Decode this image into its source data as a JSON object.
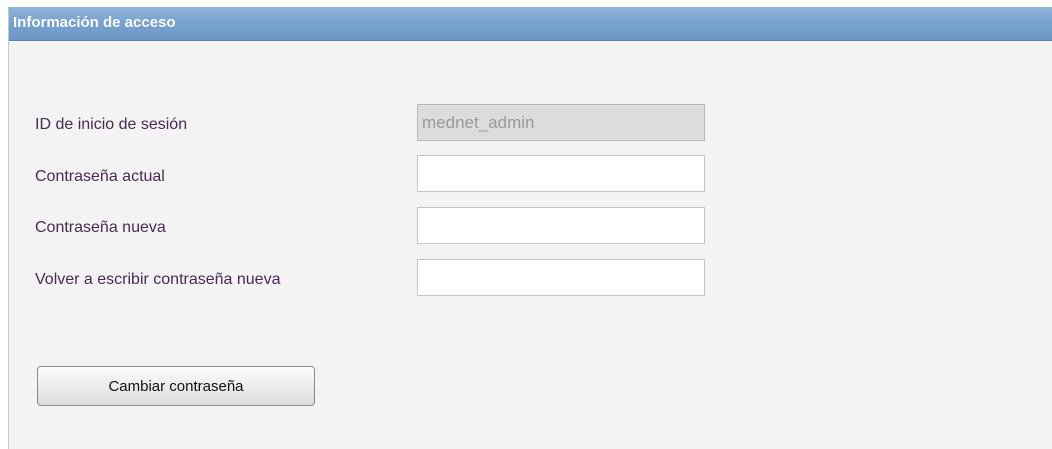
{
  "panel": {
    "title": "Información de acceso"
  },
  "form": {
    "login_id": {
      "label": "ID de inicio de sesión",
      "value": "mednet_admin"
    },
    "current_password": {
      "label": "Contraseña actual",
      "value": ""
    },
    "new_password": {
      "label": "Contraseña nueva",
      "value": ""
    },
    "confirm_password": {
      "label": "Volver a escribir contraseña nueva",
      "value": ""
    },
    "submit_label": "Cambiar contraseña"
  }
}
